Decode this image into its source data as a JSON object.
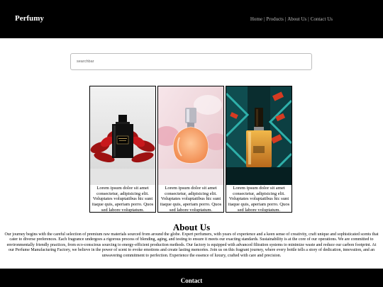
{
  "header": {
    "brand": "Perfumy",
    "nav": [
      "Home",
      "Products",
      "About Us",
      "Contact Us"
    ]
  },
  "search": {
    "placeholder": "searchbar",
    "value": ""
  },
  "products": [
    {
      "image": "perfume-bottle-image",
      "description": "Lorem ipsum dolor sit amet consectetur, adipisicing elit. Voluptates voluptatibus hic sunt itaque quis, aperiam porro. Quos sed labore voluptatum."
    },
    {
      "image": "perfume-bottle-image",
      "description": "Lorem ipsum dolor sit amet consectetur, adipisicing elit. Voluptates voluptatibus hic sunt itaque quis, aperiam porro. Quos sed labore voluptatum."
    },
    {
      "image": "perfume-bottle-image",
      "description": "Lorem ipsum dolor sit amet consectetur, adipisicing elit. Voluptates voluptatibus hic sunt itaque quis, aperiam porro. Quos sed labore voluptatum."
    }
  ],
  "about": {
    "title": "About Us",
    "body": "Our journey begins with the careful selection of premium raw materials sourced from around the globe. Expert perfumers, with years of experience and a keen sense of creativity, craft unique and sophisticated scents that cater to diverse preferences. Each fragrance undergoes a rigorous process of blending, aging, and testing to ensure it meets our exacting standards. Sustainability is at the core of our operations. We are committed to environmentally friendly practices, from eco-conscious sourcing to energy-efficient production methods. Our factory is equipped with advanced filtration systems to minimize waste and reduce our carbon footprint. At our Perfume Manufacturing Factory, we believe in the power of scent to evoke emotions and create lasting memories. Join us on this fragrant journey, where every bottle tells a story of dedication, innovation, and an unwavering commitment to perfection. Experience the essence of luxury, crafted with care and precision."
  },
  "footer": {
    "title": "Contact"
  },
  "colors": {
    "header_bg": "#000000",
    "footer_bg": "#000000",
    "nav_text": "#bbbbbb"
  }
}
